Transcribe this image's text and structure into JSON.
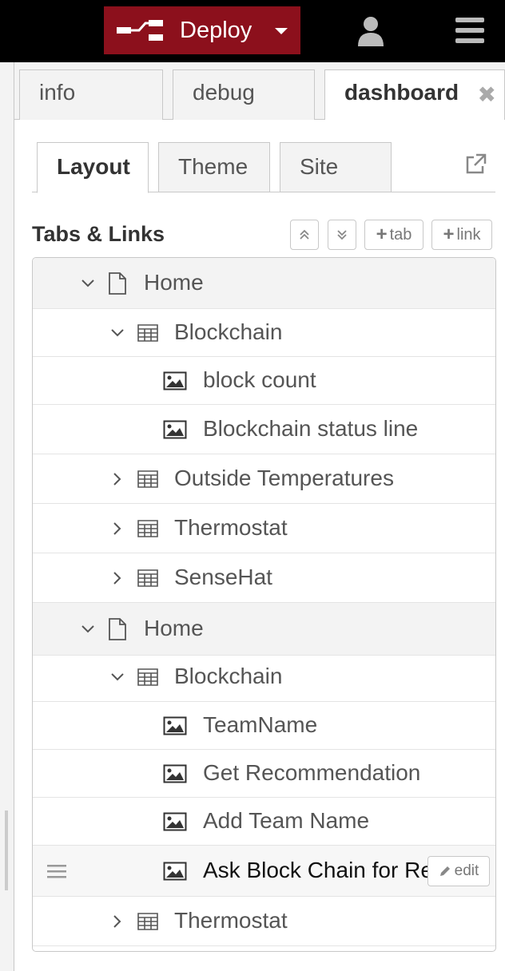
{
  "header": {
    "deploy_label": "Deploy",
    "deploy_icon": "deploy-icon",
    "user_icon": "user-icon",
    "menu_icon": "hamburger-menu-icon"
  },
  "sidebar_tabs": [
    {
      "label": "info"
    },
    {
      "label": "debug"
    },
    {
      "label": "dashboard",
      "active": true,
      "close_icon": "✖"
    }
  ],
  "dashboard": {
    "subtabs": [
      {
        "label": "Layout",
        "active": true
      },
      {
        "label": "Theme"
      },
      {
        "label": "Site"
      }
    ],
    "external_icon": "external-link-icon",
    "section_title": "Tabs & Links",
    "buttons": {
      "collapse_icon": "collapse-all-icon",
      "expand_icon": "expand-all-icon",
      "add_tab": "tab",
      "add_link": "link",
      "plus": "+"
    },
    "tree": [
      {
        "type": "page",
        "label": "Home",
        "expanded": true
      },
      {
        "type": "group",
        "label": "Blockchain",
        "expanded": true
      },
      {
        "type": "widget",
        "label": "block count"
      },
      {
        "type": "widget",
        "label": "Blockchain status line"
      },
      {
        "type": "group",
        "label": "Outside Temperatures",
        "expanded": false
      },
      {
        "type": "group",
        "label": "Thermostat",
        "expanded": false
      },
      {
        "type": "group",
        "label": "SenseHat",
        "expanded": false
      },
      {
        "type": "page",
        "label": "Home",
        "expanded": true
      },
      {
        "type": "group",
        "label": "Blockchain",
        "expanded": true
      },
      {
        "type": "widget",
        "label": "TeamName"
      },
      {
        "type": "widget",
        "label": "Get Recommendation"
      },
      {
        "type": "widget",
        "label": "Add Team Name"
      },
      {
        "type": "widget",
        "label": "Ask Block Chain for Re",
        "hovered": true,
        "edit_label": "edit"
      },
      {
        "type": "group",
        "label": "Thermostat",
        "expanded": false
      }
    ]
  }
}
